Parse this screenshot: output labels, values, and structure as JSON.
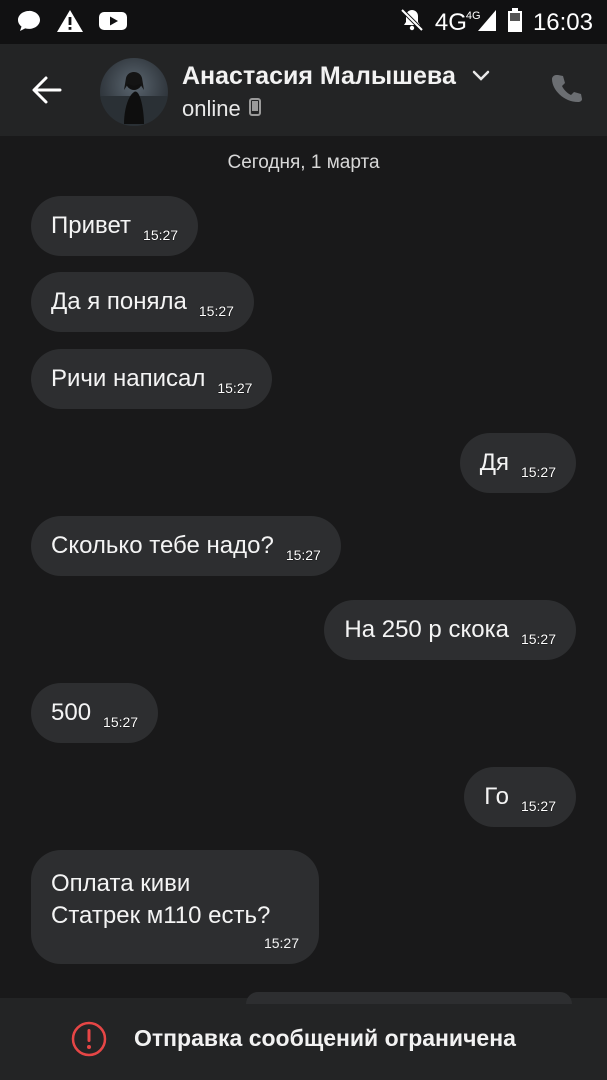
{
  "status_bar": {
    "left_icons": [
      "message-icon",
      "warning-icon",
      "youtube-icon"
    ],
    "network": "4G",
    "network_sup": "4G",
    "time": "16:03"
  },
  "header": {
    "contact_name": "Анастасия Малышева",
    "presence": "online"
  },
  "chat": {
    "date_label": "Сегодня, 1 марта",
    "messages": [
      {
        "side": "in",
        "text": "Привет",
        "time": "15:27"
      },
      {
        "side": "in",
        "text": "Да я поняла",
        "time": "15:27"
      },
      {
        "side": "in",
        "text": "Ричи написал",
        "time": "15:27"
      },
      {
        "side": "out",
        "text": "Дя",
        "time": "15:27"
      },
      {
        "side": "in",
        "text": "Сколько тебе надо?",
        "time": "15:27"
      },
      {
        "side": "out",
        "text": "На 250 р скока",
        "time": "15:27"
      },
      {
        "side": "in",
        "text": "500",
        "time": "15:27"
      },
      {
        "side": "out",
        "text": "Го",
        "time": "15:27"
      },
      {
        "side": "in",
        "lines": [
          "Оплата киви",
          "Статрек м110 есть?"
        ],
        "time": "15:27"
      }
    ]
  },
  "footer": {
    "restriction_text": "Отправка сообщений ограничена"
  },
  "colors": {
    "background": "#19191a",
    "header": "#232425",
    "bubble": "#2d2e30",
    "alert": "#e64646"
  }
}
